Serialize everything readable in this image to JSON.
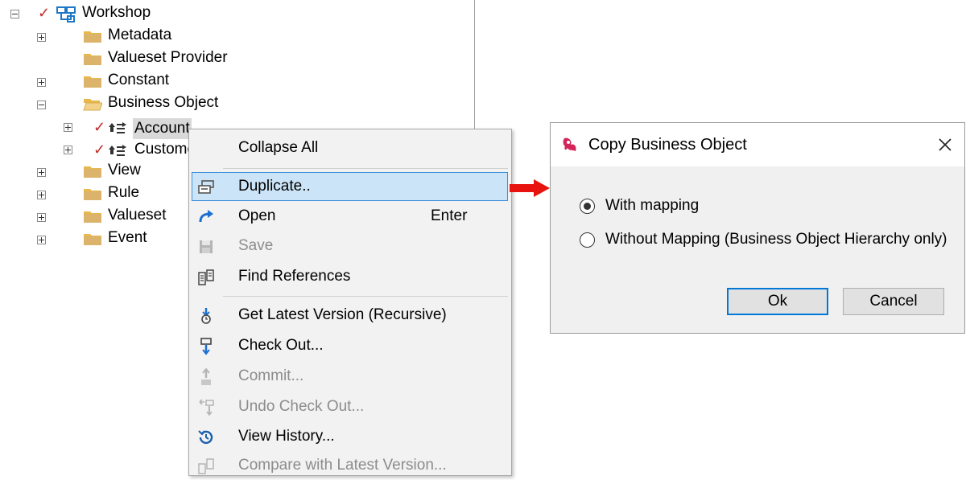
{
  "tree": {
    "root": {
      "label": "Workshop",
      "expander": "minus",
      "checked": true
    },
    "items": [
      {
        "label": "Metadata",
        "expander": "plus",
        "icon": "folder-icon"
      },
      {
        "label": "Valueset Provider",
        "expander": "",
        "icon": "folder-icon"
      },
      {
        "label": "Constant",
        "expander": "plus",
        "icon": "folder-icon"
      },
      {
        "label": "Business Object",
        "expander": "minus",
        "icon": "folder-open-icon"
      },
      {
        "label": "Account",
        "expander": "plus",
        "icon": "business-object-icon",
        "checked": true,
        "selected": true
      },
      {
        "label": "Custome",
        "expander": "plus",
        "icon": "business-object-icon",
        "checked": true
      },
      {
        "label": "View",
        "expander": "plus",
        "icon": "folder-icon"
      },
      {
        "label": "Rule",
        "expander": "plus",
        "icon": "folder-icon"
      },
      {
        "label": "Valueset",
        "expander": "plus",
        "icon": "folder-icon"
      },
      {
        "label": "Event",
        "expander": "plus",
        "icon": "folder-icon"
      }
    ]
  },
  "context_menu": {
    "items": [
      {
        "label": "Collapse All",
        "icon": "",
        "enabled": true
      },
      {
        "label": "Duplicate..",
        "icon": "duplicate-icon",
        "enabled": true,
        "highlighted": true
      },
      {
        "label": "Open",
        "shortcut": "Enter",
        "icon": "open-arrow-icon",
        "enabled": true
      },
      {
        "label": "Save",
        "icon": "save-icon",
        "enabled": false
      },
      {
        "label": "Find References",
        "icon": "find-references-icon",
        "enabled": true
      },
      {
        "label": "Get Latest Version (Recursive)",
        "icon": "get-latest-icon",
        "enabled": true
      },
      {
        "label": "Check Out...",
        "icon": "check-out-icon",
        "enabled": true
      },
      {
        "label": "Commit...",
        "icon": "commit-icon",
        "enabled": false
      },
      {
        "label": "Undo Check Out...",
        "icon": "undo-check-out-icon",
        "enabled": false
      },
      {
        "label": "View History...",
        "icon": "history-icon",
        "enabled": true
      },
      {
        "label": "Compare with Latest Version...",
        "icon": "compare-icon",
        "enabled": false
      }
    ]
  },
  "dialog": {
    "title": "Copy Business Object",
    "options": [
      {
        "label": "With mapping",
        "checked": true
      },
      {
        "label": "Without Mapping (Business Object Hierarchy only)",
        "checked": false
      }
    ],
    "ok_label": "Ok",
    "cancel_label": "Cancel"
  },
  "colors": {
    "check_red": "#c42b2b",
    "highlight_bg": "#cce4f7",
    "highlight_border": "#3c8fd9",
    "arrow_red": "#e8130e",
    "default_button_border": "#0078d7"
  }
}
